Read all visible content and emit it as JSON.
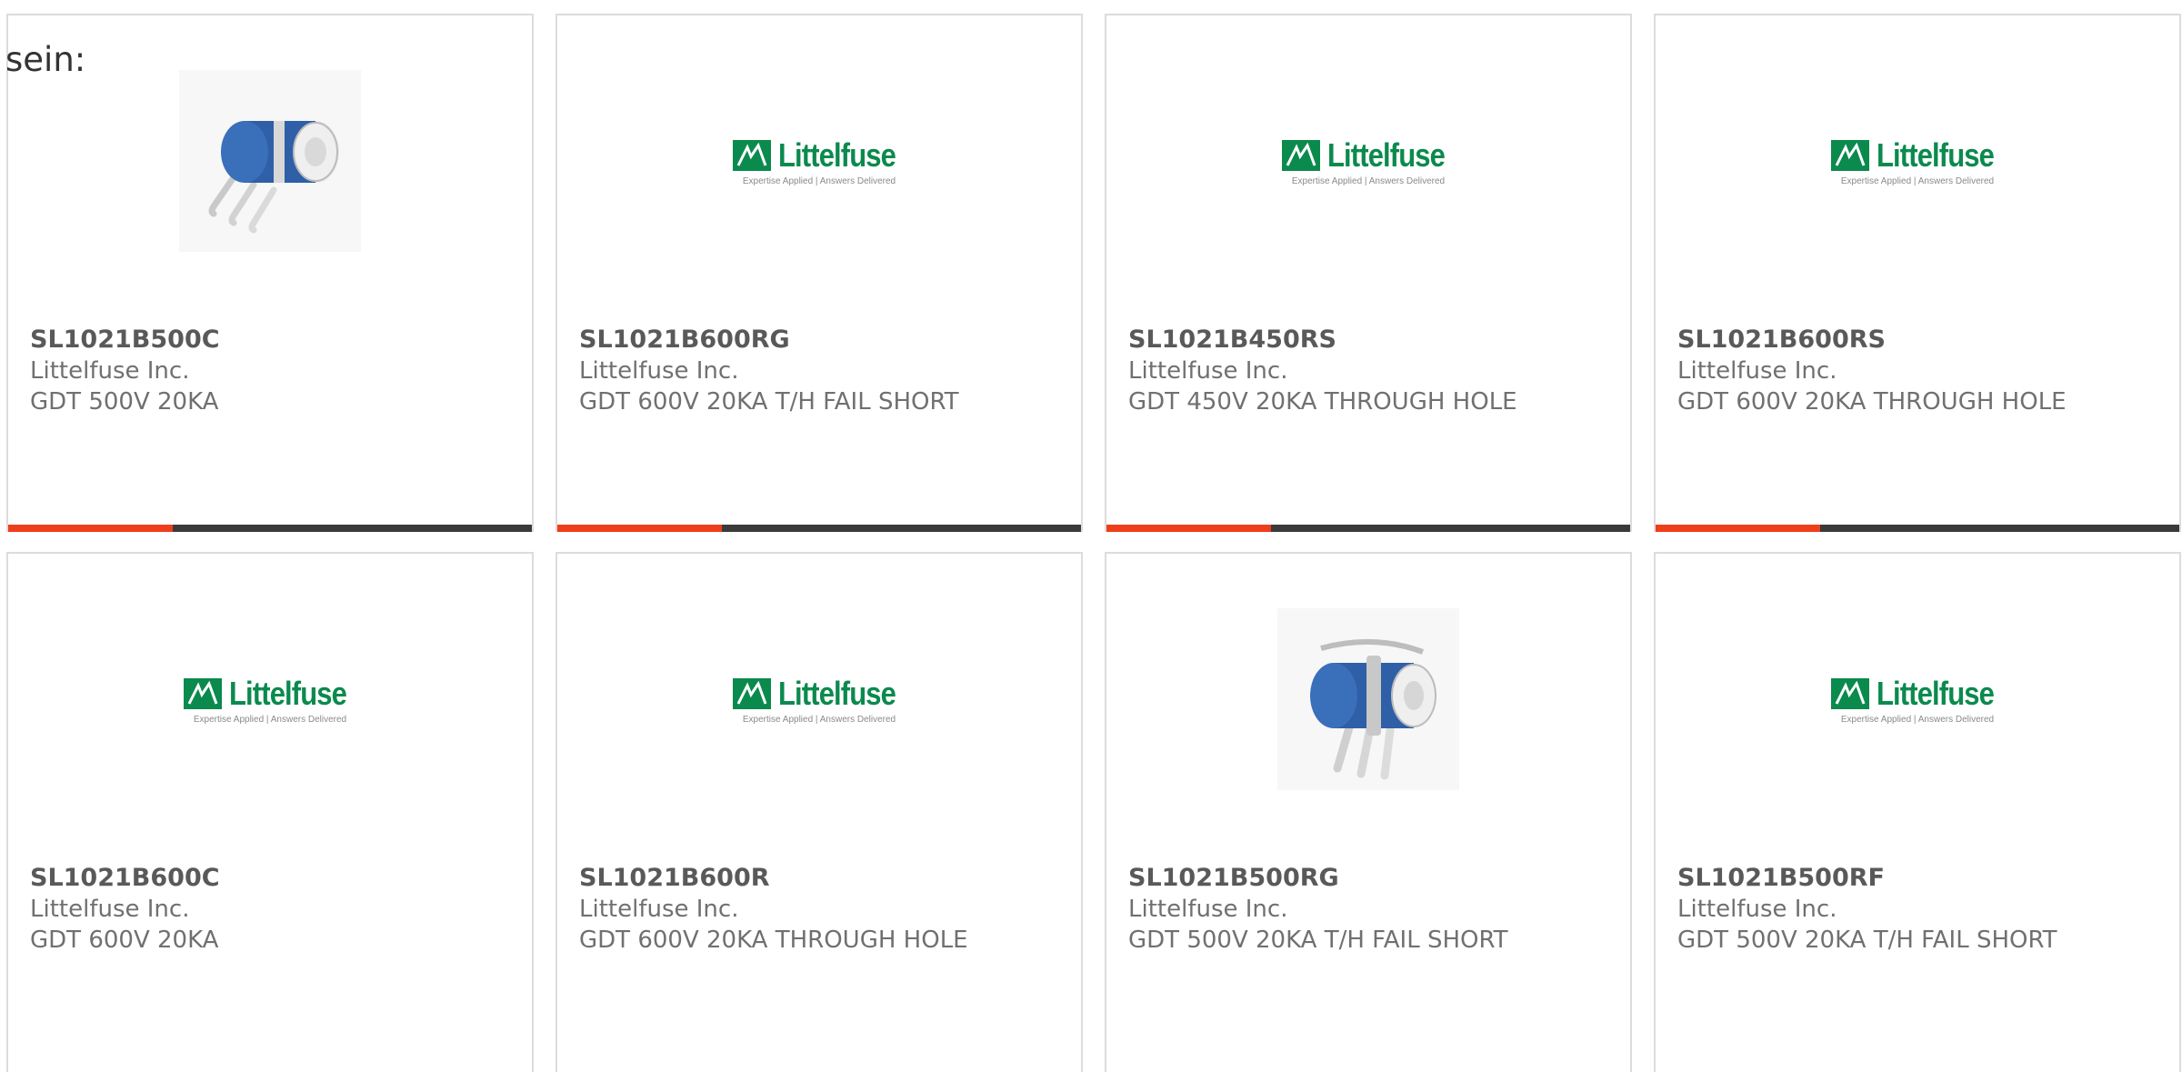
{
  "intro_text": "sein:",
  "colors": {
    "accent": "#ee3e1c",
    "bar": "#3a3a3a",
    "logo_green": "#0b8a4e"
  },
  "progress_fraction": 0.315,
  "logo": {
    "wordmark": "Littelfuse",
    "tagline": "Expertise Applied | Answers Delivered"
  },
  "products": [
    {
      "part": "SL1021B500C",
      "mfr": "Littelfuse Inc.",
      "desc": "GDT 500V 20KA",
      "image": "gdt-component-photo"
    },
    {
      "part": "SL1021B600RG",
      "mfr": "Littelfuse Inc.",
      "desc": "GDT 600V 20KA T/H FAIL SHORT",
      "image": "littelfuse-logo"
    },
    {
      "part": "SL1021B450RS",
      "mfr": "Littelfuse Inc.",
      "desc": "GDT 450V 20KA THROUGH HOLE",
      "image": "littelfuse-logo"
    },
    {
      "part": "SL1021B600RS",
      "mfr": "Littelfuse Inc.",
      "desc": "GDT 600V 20KA THROUGH HOLE",
      "image": "littelfuse-logo"
    },
    {
      "part": "SL1021B600C",
      "mfr": "Littelfuse Inc.",
      "desc": "GDT 600V 20KA",
      "image": "littelfuse-logo"
    },
    {
      "part": "SL1021B600R",
      "mfr": "Littelfuse Inc.",
      "desc": "GDT 600V 20KA THROUGH HOLE",
      "image": "littelfuse-logo"
    },
    {
      "part": "SL1021B500RG",
      "mfr": "Littelfuse Inc.",
      "desc": "GDT 500V 20KA T/H FAIL SHORT",
      "image": "gdt-component-photo-clip"
    },
    {
      "part": "SL1021B500RF",
      "mfr": "Littelfuse Inc.",
      "desc": "GDT 500V 20KA T/H FAIL SHORT",
      "image": "littelfuse-logo"
    }
  ]
}
